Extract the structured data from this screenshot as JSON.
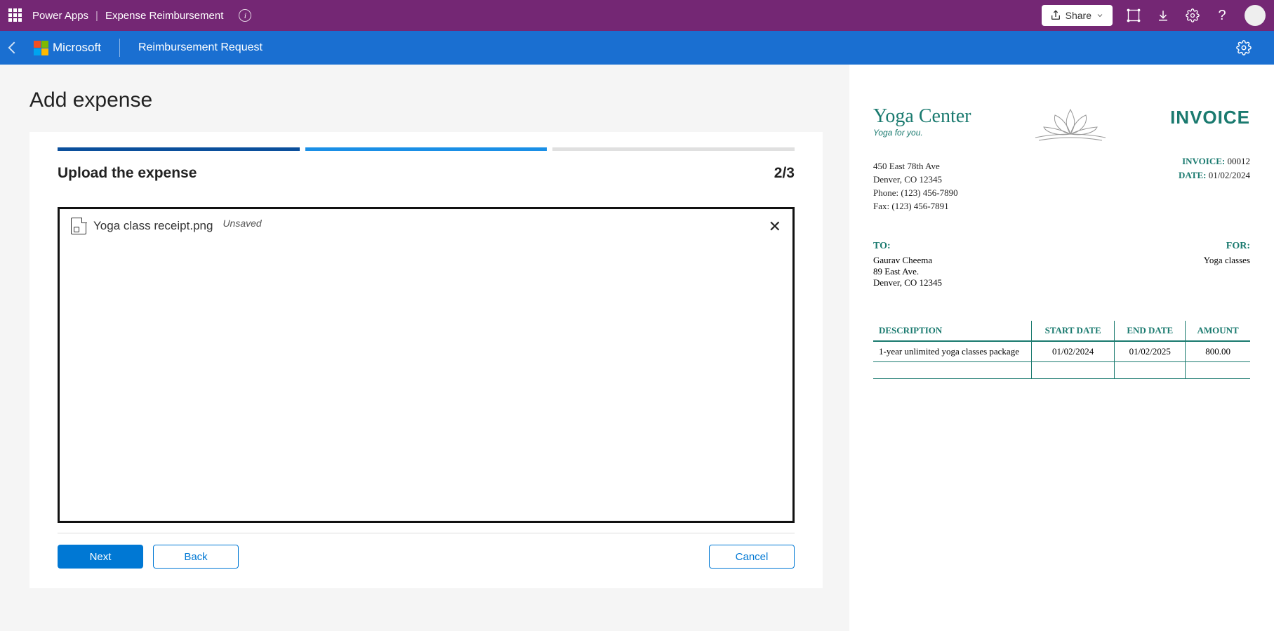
{
  "header": {
    "product": "Power Apps",
    "separator": "|",
    "appName": "Expense Reimbursement",
    "share": "Share"
  },
  "subheader": {
    "brand": "Microsoft",
    "title": "Reimbursement Request"
  },
  "page": {
    "title": "Add expense"
  },
  "wizard": {
    "stepTitle": "Upload the expense",
    "stepCount": "2/3",
    "fileName": "Yoga class receipt.png",
    "fileStatus": "Unsaved",
    "next": "Next",
    "back": "Back",
    "cancel": "Cancel"
  },
  "invoice": {
    "brand": "Yoga Center",
    "tagline": "Yoga for you.",
    "title": "INVOICE",
    "address": {
      "line1": "450 East 78th Ave",
      "line2": "Denver, CO 12345",
      "phone": "Phone: (123) 456-7890",
      "fax": "Fax: (123) 456-7891"
    },
    "meta": {
      "invoiceLabel": "INVOICE:",
      "invoiceNo": "00012",
      "dateLabel": "DATE:",
      "date": "01/02/2024"
    },
    "to": {
      "label": "TO:",
      "name": "Gaurav Cheema",
      "addr1": "89 East Ave.",
      "addr2": "Denver, CO 12345"
    },
    "for": {
      "label": "FOR:",
      "value": "Yoga classes"
    },
    "table": {
      "headers": {
        "desc": "DESCRIPTION",
        "start": "START DATE",
        "end": "END DATE",
        "amount": "AMOUNT"
      },
      "row": {
        "desc": "1-year unlimited yoga classes package",
        "start": "01/02/2024",
        "end": "01/02/2025",
        "amount": "800.00"
      }
    }
  }
}
